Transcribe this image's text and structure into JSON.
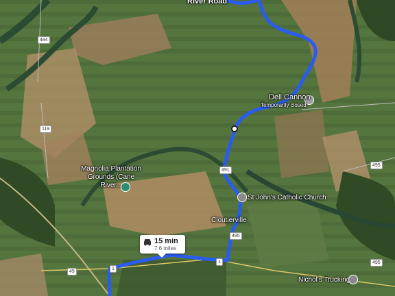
{
  "map": {
    "type": "satellite",
    "route": {
      "time": "15 min",
      "distance": "7.6 miles",
      "color": "#2b5cf0"
    },
    "places": [
      {
        "id": "river-road",
        "label": "River Road"
      },
      {
        "id": "dell-cannon",
        "label": "Dell Cannon",
        "status": "Temporarily closed"
      },
      {
        "id": "magnolia",
        "label": "Magnolia Plantation Grounds (Cane River..."
      },
      {
        "id": "st-johns",
        "label": "St John's Catholic Church"
      },
      {
        "id": "cloutierville",
        "label": "Cloutierville"
      },
      {
        "id": "nichols",
        "label": "Nichol's Trucking"
      }
    ],
    "road_shields": [
      "484",
      "119",
      "491",
      "495",
      "495",
      "495",
      "1",
      "1",
      "49"
    ]
  }
}
